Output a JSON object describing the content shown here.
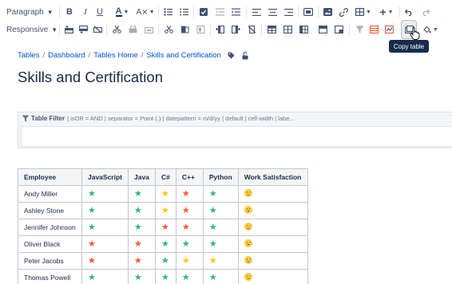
{
  "toolbar": {
    "paragraph_select": "Paragraph",
    "responsive_select": "Responsive"
  },
  "tooltip": {
    "text": "Copy table"
  },
  "breadcrumb": {
    "items": [
      "Tables",
      "Dashboard",
      "Tables Home",
      "Skills and Certification"
    ]
  },
  "page_title": "Skills and Certification",
  "table_filter": {
    "title": "Table Filter",
    "settings": "| isOR = AND | separator = Point (.) | datepattern = m/d/yy | default | cell-width | labe..."
  },
  "table": {
    "headers": [
      "Employee",
      "JavaScript",
      "Java",
      "C#",
      "C++",
      "Python",
      "Work Satisfaction"
    ],
    "rows": [
      {
        "employee": "Andy Miller",
        "skills": [
          "green",
          "green",
          "yellow",
          "red",
          "green"
        ],
        "satisfaction": "neutral"
      },
      {
        "employee": "Ashley Stone",
        "skills": [
          "green",
          "green",
          "yellow",
          "red",
          "green"
        ],
        "satisfaction": "happy"
      },
      {
        "employee": "Jennifer Johnson",
        "skills": [
          "green",
          "green",
          "red",
          "red",
          "green"
        ],
        "satisfaction": "sad"
      },
      {
        "employee": "Oliver Black",
        "skills": [
          "red",
          "red",
          "green",
          "green",
          "green"
        ],
        "satisfaction": "happy"
      },
      {
        "employee": "Peter Jacobs",
        "skills": [
          "red",
          "red",
          "green",
          "yellow",
          "yellow"
        ],
        "satisfaction": "neutral"
      },
      {
        "employee": "Thomas Powell",
        "skills": [
          "green",
          "green",
          "green",
          "green",
          "green"
        ],
        "satisfaction": "neutral"
      }
    ]
  },
  "colors": {
    "green_star": "#36b37e",
    "yellow_star": "#ffc400",
    "red_star": "#ff5630",
    "link": "#0052cc",
    "emoji_face": "#ffd23f"
  }
}
